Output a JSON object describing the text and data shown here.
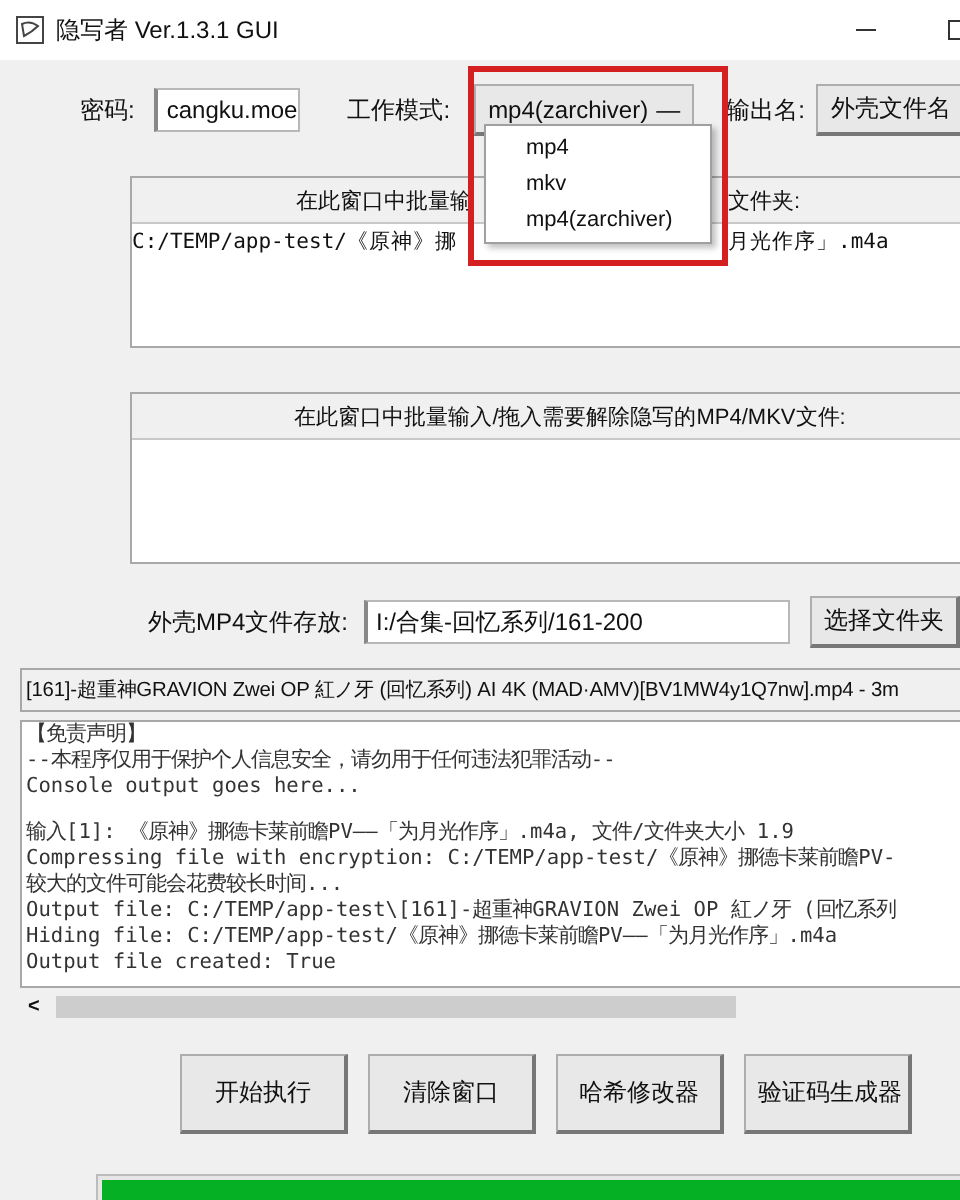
{
  "window": {
    "title": "隐写者 Ver.1.3.1 GUI"
  },
  "settings": {
    "password_label": "密码:",
    "password": "cangku.moe",
    "mode_label": "工作模式:",
    "mode": "mp4(zarchiver)",
    "mode_caret": "—",
    "output_label": "输出名:",
    "output_button": "外壳文件名"
  },
  "mode_menu": {
    "items": [
      "mp4",
      "mkv",
      "mp4(zarchiver)"
    ]
  },
  "hide_panel": {
    "header_left": "在此窗口中批量输",
    "header_right": "文件夹:",
    "path_left": "C:/TEMP/app-test/《原神》挪",
    "path_right": "月光作序」.m4a"
  },
  "reveal_panel": {
    "header": "在此窗口中批量输入/拖入需要解除隐写的MP4/MKV文件:"
  },
  "storage": {
    "label": "外壳MP4文件存放:",
    "path": "I:/合集-回忆系列/161-200",
    "button": "选择文件夹"
  },
  "selected_file": "[161]-超重神GRAVION Zwei OP 紅ノ牙 (回忆系列) AI 4K (MAD·AMV)[BV1MW4y1Q7nw].mp4 - 3m",
  "console": [
    [
      "【免责声明】",
      "--本程序仅用于保护个人信息安全，请勿用于任何违法犯罪活动--",
      "Console output goes here..."
    ],
    [
      "输入[1]: 《原神》挪德卡莱前瞻PV——「为月光作序」.m4a, 文件/文件夹大小 1.9",
      "Compressing file with encryption: C:/TEMP/app-test/《原神》挪德卡莱前瞻PV-",
      "较大的文件可能会花费较长时间...",
      "Output file: C:/TEMP/app-test\\[161]-超重神GRAVION Zwei OP 紅ノ牙 (回忆系列",
      "Hiding file: C:/TEMP/app-test/《原神》挪德卡莱前瞻PV——「为月光作序」.m4a",
      "Output file created: True"
    ]
  ],
  "scroll_arrow": "<",
  "buttons": [
    "开始执行",
    "清除窗口",
    "哈希修改器",
    "验证码生成器"
  ],
  "progress": {
    "level": 1
  }
}
